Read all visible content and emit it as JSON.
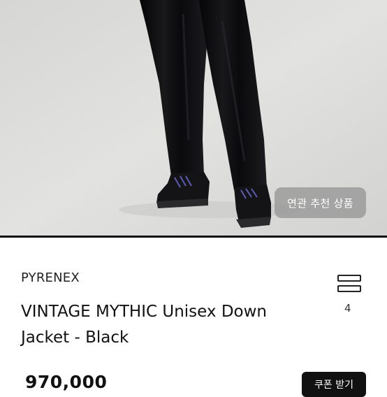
{
  "hero": {
    "image_alt": "model wearing black velvet trousers and black hiking boots",
    "related_button_label": "연관 추천 상품"
  },
  "product": {
    "brand": "PYRENEX",
    "title": "VINTAGE MYTHIC Unisex Down Jacket - Black",
    "price": "970,000"
  },
  "menu": {
    "count": "4",
    "icon": "stacked-bars-icon"
  },
  "coupon": {
    "label": "쿠폰 받기"
  },
  "colors": {
    "hero_background": "#dcdcda",
    "garment": "#0c0c0e",
    "button_dark": "#111111"
  }
}
